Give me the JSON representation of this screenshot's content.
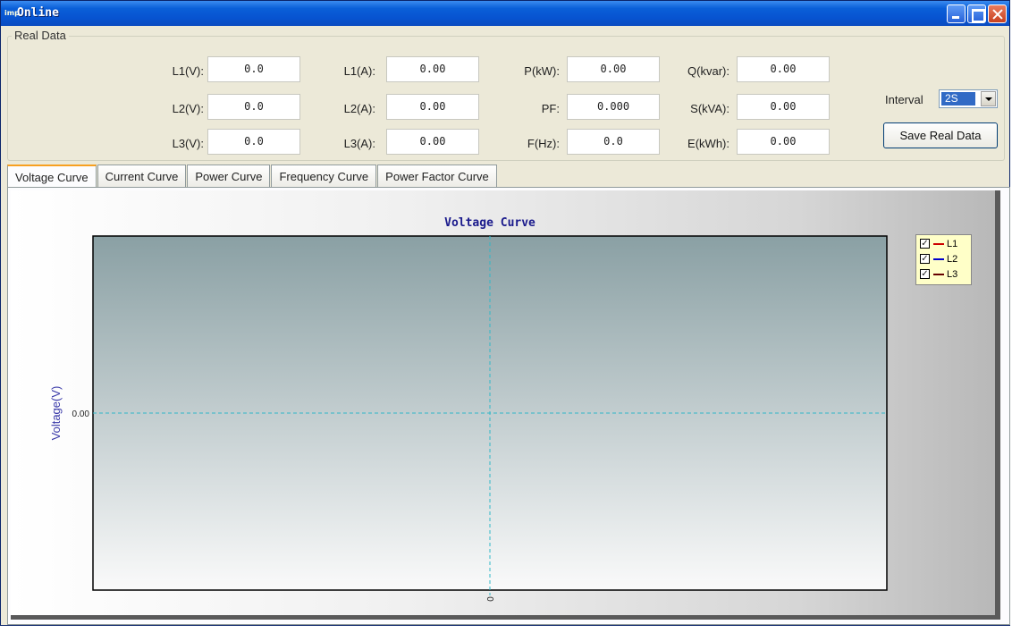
{
  "window": {
    "icon": "app-icon",
    "title": "Online"
  },
  "group": {
    "title": "Real Data"
  },
  "fields": [
    {
      "label": "L1(V):",
      "value": "0.0"
    },
    {
      "label": "L1(A):",
      "value": "0.00"
    },
    {
      "label": "P(kW):",
      "value": "0.00"
    },
    {
      "label": "Q(kvar):",
      "value": "0.00"
    },
    {
      "label": "L2(V):",
      "value": "0.0"
    },
    {
      "label": "L2(A):",
      "value": "0.00"
    },
    {
      "label": "PF:",
      "value": "0.000"
    },
    {
      "label": "S(kVA):",
      "value": "0.00"
    },
    {
      "label": "L3(V):",
      "value": "0.0"
    },
    {
      "label": "L3(A):",
      "value": "0.00"
    },
    {
      "label": "F(Hz):",
      "value": "0.0"
    },
    {
      "label": "E(kWh):",
      "value": "0.00"
    }
  ],
  "interval": {
    "label": "Interval",
    "value": "2S"
  },
  "save_button": "Save Real Data",
  "tabs": [
    {
      "label": "Voltage Curve",
      "active": true
    },
    {
      "label": "Current Curve",
      "active": false
    },
    {
      "label": "Power Curve",
      "active": false
    },
    {
      "label": "Frequency Curve",
      "active": false
    },
    {
      "label": "Power Factor Curve",
      "active": false
    }
  ],
  "chart_data": {
    "type": "line",
    "title": "Voltage Curve",
    "xlabel": "",
    "ylabel": "Voltage(V)",
    "x_ticks": [
      "0"
    ],
    "y_ticks": [
      "0.00"
    ],
    "series": [
      {
        "name": "L1",
        "values": [],
        "color": "#cc0000",
        "checked": true
      },
      {
        "name": "L2",
        "values": [],
        "color": "#0000cc",
        "checked": true
      },
      {
        "name": "L3",
        "values": [],
        "color": "#660000",
        "checked": true
      }
    ],
    "grid": true,
    "legend_position": "top-right"
  },
  "colors": {
    "title_text": "#1a1a8c",
    "ylabel": "#3838a8",
    "grid": "#30b8c8",
    "plot_top": "#8aa0a4",
    "plot_bottom": "#fafafa"
  }
}
